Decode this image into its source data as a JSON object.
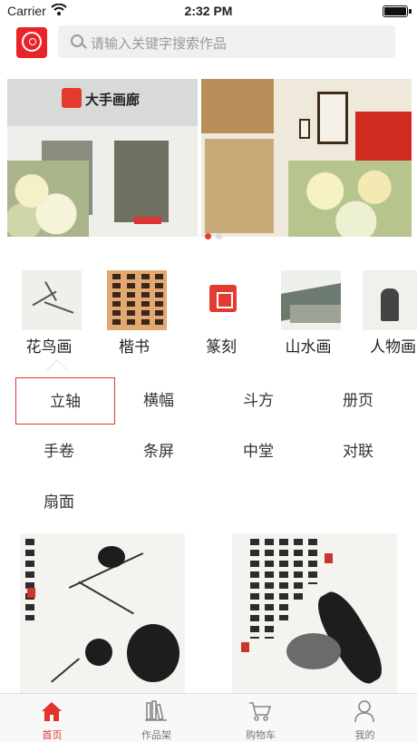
{
  "status_bar": {
    "carrier": "Carrier",
    "time": "2:32 PM"
  },
  "header": {
    "search_placeholder": "请输入关键字搜索作品",
    "logo_icon": "gallery-logo-icon"
  },
  "banner": {
    "shop_sign": "大手画廊",
    "slide_count": 2,
    "active_slide": 1
  },
  "categories": [
    {
      "label": "花鸟画"
    },
    {
      "label": "楷书"
    },
    {
      "label": "篆刻"
    },
    {
      "label": "山水画"
    },
    {
      "label": "人物画"
    }
  ],
  "subcategories": [
    {
      "label": "立轴",
      "selected": true
    },
    {
      "label": "横幅"
    },
    {
      "label": "斗方"
    },
    {
      "label": "册页"
    },
    {
      "label": "手卷"
    },
    {
      "label": "条屏"
    },
    {
      "label": "中堂"
    },
    {
      "label": "对联"
    },
    {
      "label": "扇面"
    }
  ],
  "tabbar": {
    "items": [
      {
        "label": "首页",
        "icon": "home-icon",
        "active": true
      },
      {
        "label": "作品架",
        "icon": "bookshelf-icon"
      },
      {
        "label": "购物车",
        "icon": "cart-icon"
      },
      {
        "label": "我的",
        "icon": "user-icon"
      }
    ]
  },
  "colors": {
    "accent": "#e2332d",
    "placeholder": "#9a9a9a",
    "tab_inactive": "#777777"
  }
}
